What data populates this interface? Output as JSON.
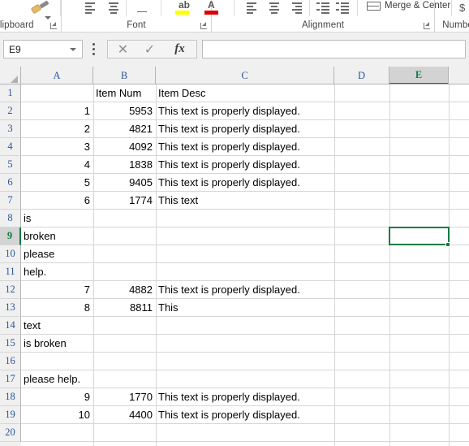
{
  "ribbon": {
    "groups": [
      {
        "label": "Clipboard"
      },
      {
        "label": "Font"
      },
      {
        "label": "Alignment"
      },
      {
        "label": "Number"
      }
    ],
    "merge_center_label": "Merge & Center"
  },
  "formula_bar": {
    "name_box_value": "E9",
    "formula_value": "",
    "cancel_icon": "✕",
    "enter_icon": "✓",
    "function_icon": "fx"
  },
  "grid": {
    "columns": [
      {
        "label": "A",
        "selected": false
      },
      {
        "label": "B",
        "selected": false
      },
      {
        "label": "C",
        "selected": false
      },
      {
        "label": "D",
        "selected": false
      },
      {
        "label": "E",
        "selected": true
      }
    ],
    "rows": [
      {
        "num": "1",
        "selected": false,
        "A": "",
        "B": "Item Num",
        "C": "Item Desc",
        "A_align": "txt",
        "B_align": "txt",
        "C_align": "txt"
      },
      {
        "num": "2",
        "selected": false,
        "A": "1",
        "B": "5953",
        "C": "This text is properly displayed.",
        "A_align": "num",
        "B_align": "num",
        "C_align": "txt"
      },
      {
        "num": "3",
        "selected": false,
        "A": "2",
        "B": "4821",
        "C": "This text is properly displayed.",
        "A_align": "num",
        "B_align": "num",
        "C_align": "txt"
      },
      {
        "num": "4",
        "selected": false,
        "A": "3",
        "B": "4092",
        "C": "This text is properly displayed.",
        "A_align": "num",
        "B_align": "num",
        "C_align": "txt"
      },
      {
        "num": "5",
        "selected": false,
        "A": "4",
        "B": "1838",
        "C": "This text is properly displayed.",
        "A_align": "num",
        "B_align": "num",
        "C_align": "txt"
      },
      {
        "num": "6",
        "selected": false,
        "A": "5",
        "B": "9405",
        "C": "This text is properly displayed.",
        "A_align": "num",
        "B_align": "num",
        "C_align": "txt"
      },
      {
        "num": "7",
        "selected": false,
        "A": "6",
        "B": "1774",
        "C": "This text",
        "A_align": "num",
        "B_align": "num",
        "C_align": "txt"
      },
      {
        "num": "8",
        "selected": false,
        "A": "is",
        "B": "",
        "C": "",
        "A_align": "txt",
        "B_align": "txt",
        "C_align": "txt"
      },
      {
        "num": "9",
        "selected": true,
        "A": "broken",
        "B": "",
        "C": "",
        "A_align": "txt",
        "B_align": "txt",
        "C_align": "txt"
      },
      {
        "num": "10",
        "selected": false,
        "A": "please",
        "B": "",
        "C": "",
        "A_align": "txt",
        "B_align": "txt",
        "C_align": "txt"
      },
      {
        "num": "11",
        "selected": false,
        "A": "help.",
        "B": "",
        "C": "",
        "A_align": "txt",
        "B_align": "txt",
        "C_align": "txt"
      },
      {
        "num": "12",
        "selected": false,
        "A": "7",
        "B": "4882",
        "C": "This text is properly displayed.",
        "A_align": "num",
        "B_align": "num",
        "C_align": "txt"
      },
      {
        "num": "13",
        "selected": false,
        "A": "8",
        "B": "8811",
        "C": "This",
        "A_align": "num",
        "B_align": "num",
        "C_align": "txt"
      },
      {
        "num": "14",
        "selected": false,
        "A": "text",
        "B": "",
        "C": "",
        "A_align": "txt",
        "B_align": "txt",
        "C_align": "txt"
      },
      {
        "num": "15",
        "selected": false,
        "A": "is broken",
        "B": "",
        "C": "",
        "A_align": "txt",
        "B_align": "txt",
        "C_align": "txt"
      },
      {
        "num": "16",
        "selected": false,
        "A": "",
        "B": "",
        "C": "",
        "A_align": "txt",
        "B_align": "txt",
        "C_align": "txt"
      },
      {
        "num": "17",
        "selected": false,
        "A": "please help.",
        "B": "",
        "C": "",
        "A_align": "txt",
        "B_align": "txt",
        "C_align": "txt"
      },
      {
        "num": "18",
        "selected": false,
        "A": "9",
        "B": "1770",
        "C": "This text is properly displayed.",
        "A_align": "num",
        "B_align": "num",
        "C_align": "txt"
      },
      {
        "num": "19",
        "selected": false,
        "A": "10",
        "B": "4400",
        "C": "This text is properly displayed.",
        "A_align": "num",
        "B_align": "num",
        "C_align": "txt"
      },
      {
        "num": "20",
        "selected": false,
        "A": "",
        "B": "",
        "C": "",
        "A_align": "txt",
        "B_align": "txt",
        "C_align": "txt"
      }
    ],
    "active_cell": "E9",
    "active_cell_col_index": 4,
    "active_cell_row_index": 8
  },
  "colors": {
    "accent_green": "#107c41",
    "header_blue": "#2a5699",
    "highlight_yellow": "#ffff00",
    "font_color_red": "#e00000",
    "header_bg": "#f0f0f0",
    "header_selected_bg": "#d3d3d3",
    "gridline": "#d6d6d6"
  }
}
